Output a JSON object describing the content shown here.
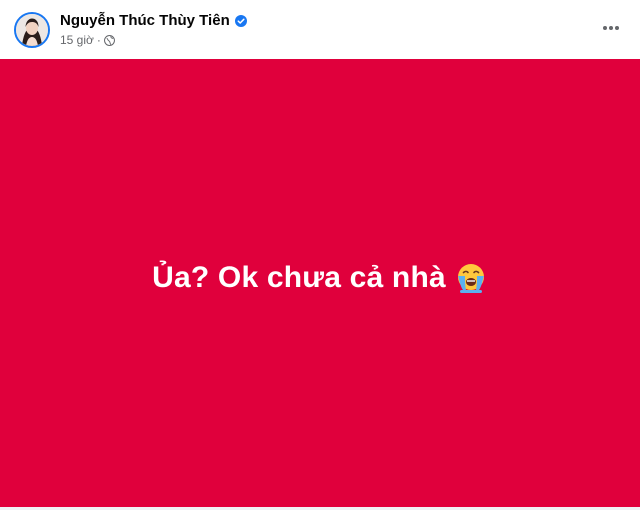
{
  "post": {
    "author": {
      "name": "Nguyễn Thúc Thùy Tiên",
      "verified": true,
      "avatar_icon": "profile-photo"
    },
    "timestamp": "15 giờ",
    "separator": "·",
    "privacy_icon": "globe-icon",
    "more_icon": "more-horizontal-icon",
    "body": {
      "background_color": "#e0003c",
      "text": "Ủa? Ok chưa cả nhà",
      "emoji_icon": "loudly-crying-face-icon"
    }
  },
  "colors": {
    "verified_badge": "#1877f2",
    "text_primary": "#050505",
    "text_secondary": "#65676b"
  }
}
